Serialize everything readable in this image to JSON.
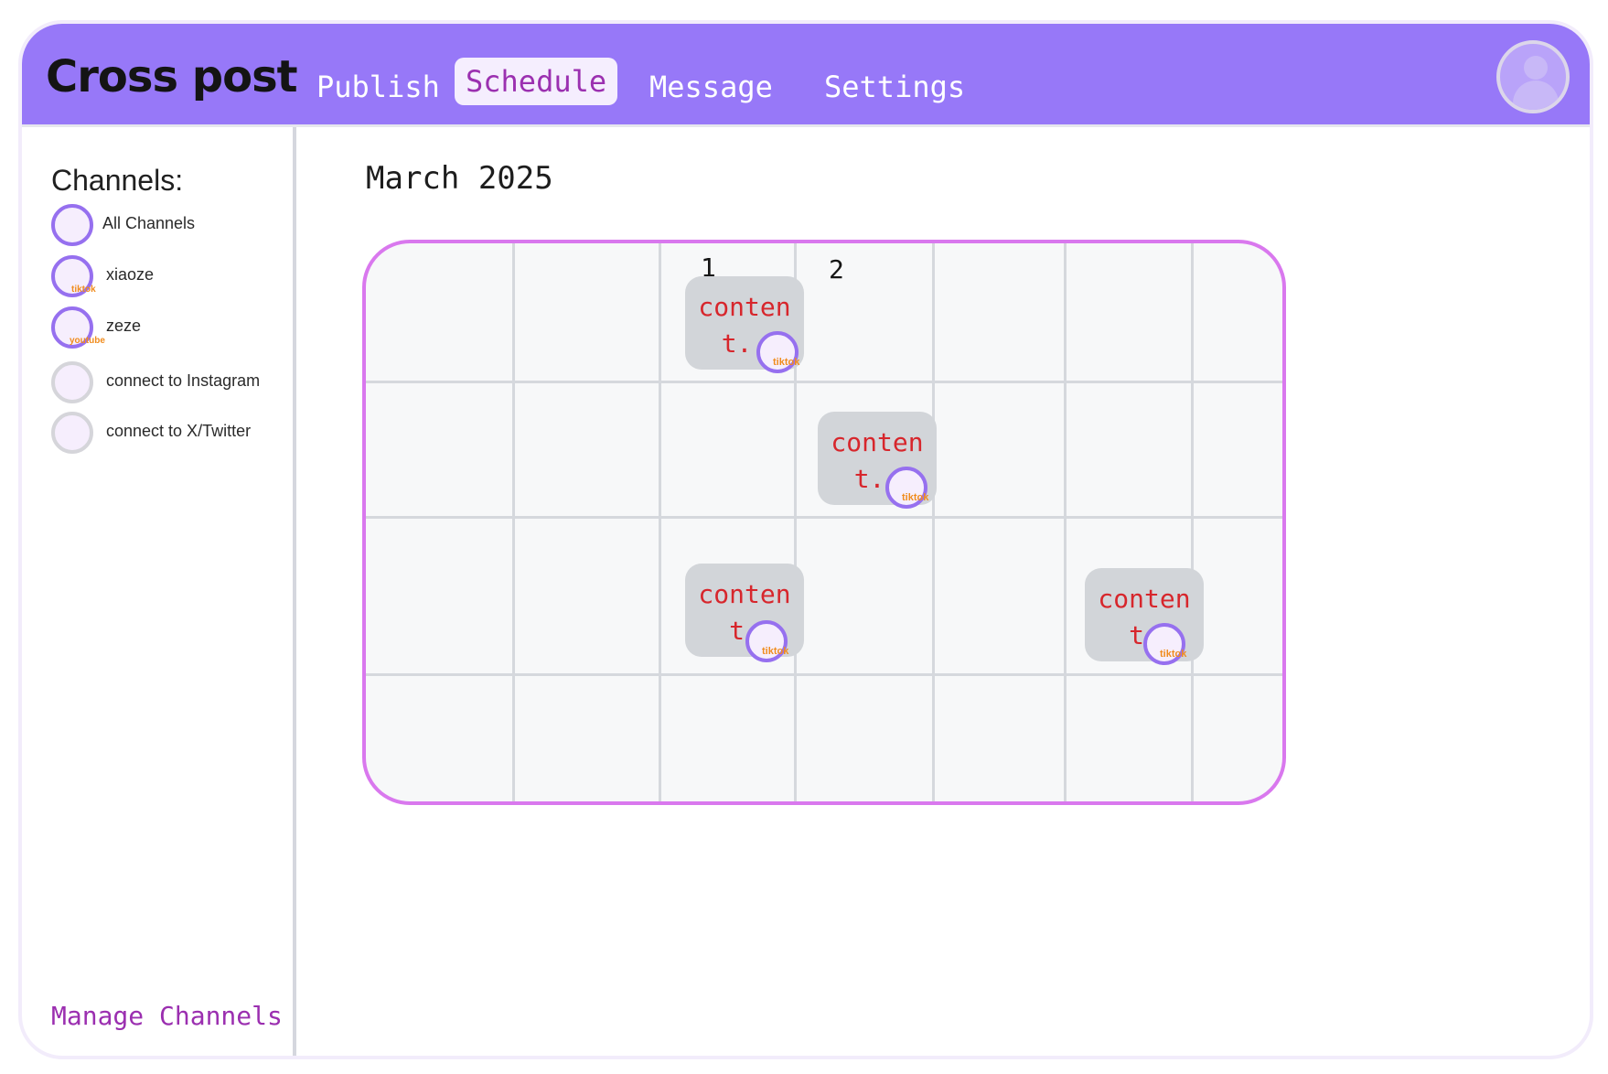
{
  "app": {
    "title": "Cross post"
  },
  "nav": {
    "publish": "Publish",
    "schedule": "Schedule",
    "message": "Message",
    "settings": "Settings",
    "active": "Schedule"
  },
  "sidebar": {
    "title": "Channels:",
    "items": [
      {
        "label": "All Channels",
        "platform": "",
        "connected": true
      },
      {
        "label": "xiaoze",
        "platform": "tiktok",
        "connected": true
      },
      {
        "label": "zeze",
        "platform": "youtube",
        "connected": true
      },
      {
        "label": "connect to Instagram",
        "platform": "",
        "connected": false
      },
      {
        "label": "connect to X/Twitter",
        "platform": "",
        "connected": false
      }
    ],
    "manage_label": "Manage Channels"
  },
  "calendar": {
    "month": "March 2025",
    "day_labels": [
      "1",
      "2"
    ],
    "events": [
      {
        "text_line1": "conten",
        "text_line2": "t..",
        "platform": "tiktok"
      },
      {
        "text_line1": "conten",
        "text_line2": "t..",
        "platform": "tiktok"
      },
      {
        "text_line1": "conten",
        "text_line2": "t.",
        "platform": "tiktok"
      },
      {
        "text_line1": "conten",
        "text_line2": "t.",
        "platform": "tiktok"
      }
    ]
  },
  "colors": {
    "topbar": "#9778f8",
    "accent_purple": "#9b2fb0",
    "calendar_border": "#d978ee",
    "event_text": "#d7262c",
    "platform_tag": "#f08c1e"
  }
}
